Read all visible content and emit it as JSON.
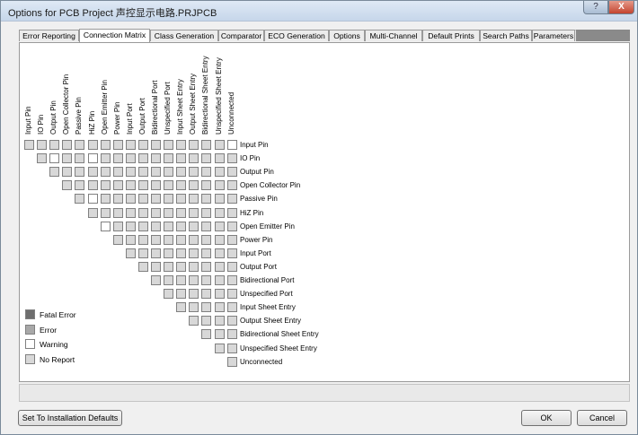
{
  "window": {
    "title": "Options for PCB Project 声控显示电路.PRJPCB",
    "help_label": "?",
    "close_label": "X"
  },
  "tabs": [
    {
      "label": "Error Reporting",
      "active": false
    },
    {
      "label": "Connection Matrix",
      "active": true
    },
    {
      "label": "Class Generation",
      "active": false
    },
    {
      "label": "Comparator",
      "active": false
    },
    {
      "label": "ECO Generation",
      "active": false
    },
    {
      "label": "Options",
      "active": false
    },
    {
      "label": "Multi-Channel",
      "active": false
    },
    {
      "label": "Default Prints",
      "active": false
    },
    {
      "label": "Search Paths",
      "active": false
    },
    {
      "label": "Parameters",
      "active": false
    }
  ],
  "matrix": {
    "labels": [
      "Input Pin",
      "IO Pin",
      "Output Pin",
      "Open Collector Pin",
      "Passive Pin",
      "HiZ Pin",
      "Open Emitter Pin",
      "Power Pin",
      "Input Port",
      "Output Port",
      "Bidirectional Port",
      "Unspecified Port",
      "Input Sheet Entry",
      "Output Sheet Entry",
      "Bidirectional Sheet Entry",
      "Unspecified Sheet Entry",
      "Unconnected"
    ],
    "cells": [
      [
        "noreport",
        "noreport",
        "noreport",
        "noreport",
        "noreport",
        "noreport",
        "noreport",
        "noreport",
        "noreport",
        "noreport",
        "noreport",
        "noreport",
        "noreport",
        "noreport",
        "noreport",
        "noreport",
        "warning"
      ],
      [
        "noreport",
        "warning",
        "noreport",
        "noreport",
        "warning",
        "noreport",
        "noreport",
        "noreport",
        "noreport",
        "noreport",
        "noreport",
        "noreport",
        "noreport",
        "noreport",
        "noreport",
        "noreport"
      ],
      [
        "noreport",
        "noreport",
        "noreport",
        "noreport",
        "noreport",
        "noreport",
        "noreport",
        "noreport",
        "noreport",
        "noreport",
        "noreport",
        "noreport",
        "noreport",
        "noreport",
        "noreport"
      ],
      [
        "noreport",
        "noreport",
        "noreport",
        "noreport",
        "noreport",
        "noreport",
        "noreport",
        "noreport",
        "noreport",
        "noreport",
        "noreport",
        "noreport",
        "noreport",
        "noreport"
      ],
      [
        "noreport",
        "warning",
        "noreport",
        "noreport",
        "noreport",
        "noreport",
        "noreport",
        "noreport",
        "noreport",
        "noreport",
        "noreport",
        "noreport",
        "noreport"
      ],
      [
        "noreport",
        "noreport",
        "noreport",
        "noreport",
        "noreport",
        "noreport",
        "noreport",
        "noreport",
        "noreport",
        "noreport",
        "noreport",
        "noreport"
      ],
      [
        "warning",
        "noreport",
        "noreport",
        "noreport",
        "noreport",
        "noreport",
        "noreport",
        "noreport",
        "noreport",
        "noreport",
        "noreport"
      ],
      [
        "noreport",
        "noreport",
        "noreport",
        "noreport",
        "noreport",
        "noreport",
        "noreport",
        "noreport",
        "noreport",
        "noreport"
      ],
      [
        "noreport",
        "noreport",
        "noreport",
        "noreport",
        "noreport",
        "noreport",
        "noreport",
        "noreport",
        "noreport"
      ],
      [
        "noreport",
        "noreport",
        "noreport",
        "noreport",
        "noreport",
        "noreport",
        "noreport",
        "noreport"
      ],
      [
        "noreport",
        "noreport",
        "noreport",
        "noreport",
        "noreport",
        "noreport",
        "noreport"
      ],
      [
        "noreport",
        "noreport",
        "noreport",
        "noreport",
        "noreport",
        "noreport"
      ],
      [
        "noreport",
        "noreport",
        "noreport",
        "noreport",
        "noreport"
      ],
      [
        "noreport",
        "noreport",
        "noreport",
        "noreport"
      ],
      [
        "noreport",
        "noreport",
        "noreport"
      ],
      [
        "noreport",
        "noreport"
      ],
      [
        "noreport"
      ]
    ]
  },
  "legend": [
    {
      "key": "fatal",
      "label": "Fatal Error"
    },
    {
      "key": "error",
      "label": "Error"
    },
    {
      "key": "warning",
      "label": "Warning"
    },
    {
      "key": "noreport",
      "label": "No Report"
    }
  ],
  "buttons": {
    "defaults": "Set To Installation Defaults",
    "ok": "OK",
    "cancel": "Cancel"
  }
}
